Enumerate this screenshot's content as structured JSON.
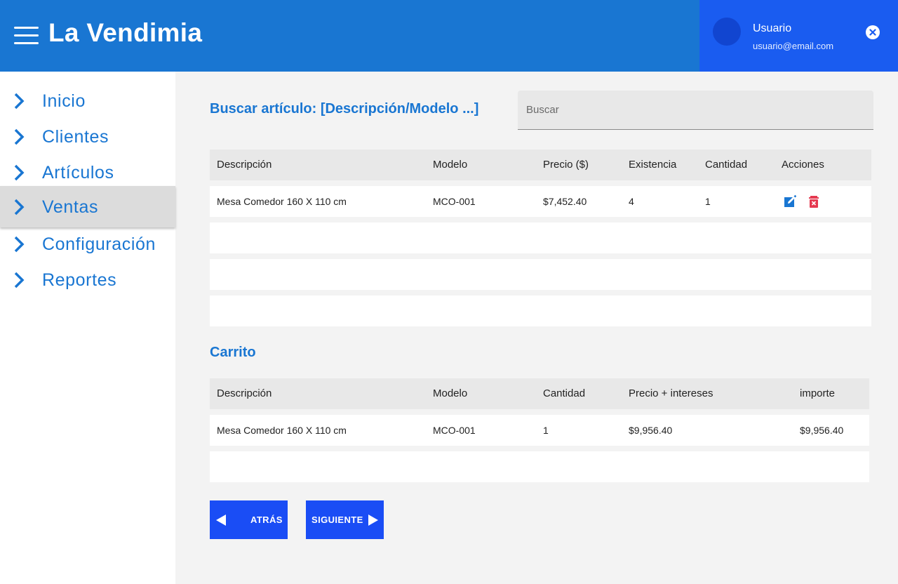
{
  "header": {
    "title": "La Vendimia",
    "user": {
      "name": "Usuario",
      "email": "usuario@email.com"
    },
    "colors": {
      "header_bg": "#1976d2",
      "user_panel_bg": "#1a5cf0"
    }
  },
  "sidebar": {
    "items": [
      {
        "label": "Inicio",
        "active": false
      },
      {
        "label": "Clientes",
        "active": false
      },
      {
        "label": "Artículos",
        "active": false
      },
      {
        "label": "Ventas",
        "active": true
      },
      {
        "label": "Configuración",
        "active": false
      },
      {
        "label": "Reportes",
        "active": false
      }
    ]
  },
  "search": {
    "label": "Buscar artículo: [Descripción/Modelo ...]",
    "placeholder": "Buscar",
    "value": ""
  },
  "articles_table": {
    "headers": [
      "Descripción",
      "Modelo",
      "Precio ($)",
      "Existencia",
      "Cantidad",
      "Acciones"
    ],
    "rows": [
      {
        "descripcion": "Mesa Comedor 160 X 110 cm",
        "modelo": "MCO-001",
        "precio": "$7,452.40",
        "existencia": "4",
        "cantidad": "1",
        "actions": [
          "edit-icon",
          "delete-icon"
        ]
      }
    ],
    "empty_rows": 3
  },
  "cart": {
    "title": "Carrito",
    "headers": [
      "Descripción",
      "Modelo",
      "Cantidad",
      "Precio + intereses",
      "importe"
    ],
    "rows": [
      {
        "descripcion": "Mesa Comedor 160 X 110 cm",
        "modelo": "MCO-001",
        "cantidad": "1",
        "precio_intereses": "$9,956.40",
        "importe": "$9,956.40"
      }
    ],
    "empty_rows": 1
  },
  "buttons": {
    "back": {
      "label": "ATRÁS",
      "icon": "arrow-left-icon"
    },
    "next": {
      "label": "SIGUIENTE",
      "icon": "arrow-right-icon"
    }
  },
  "colors": {
    "accent": "#1976d2",
    "button": "#1a4df5",
    "edit": "#1976d2",
    "delete": "#e53950"
  }
}
